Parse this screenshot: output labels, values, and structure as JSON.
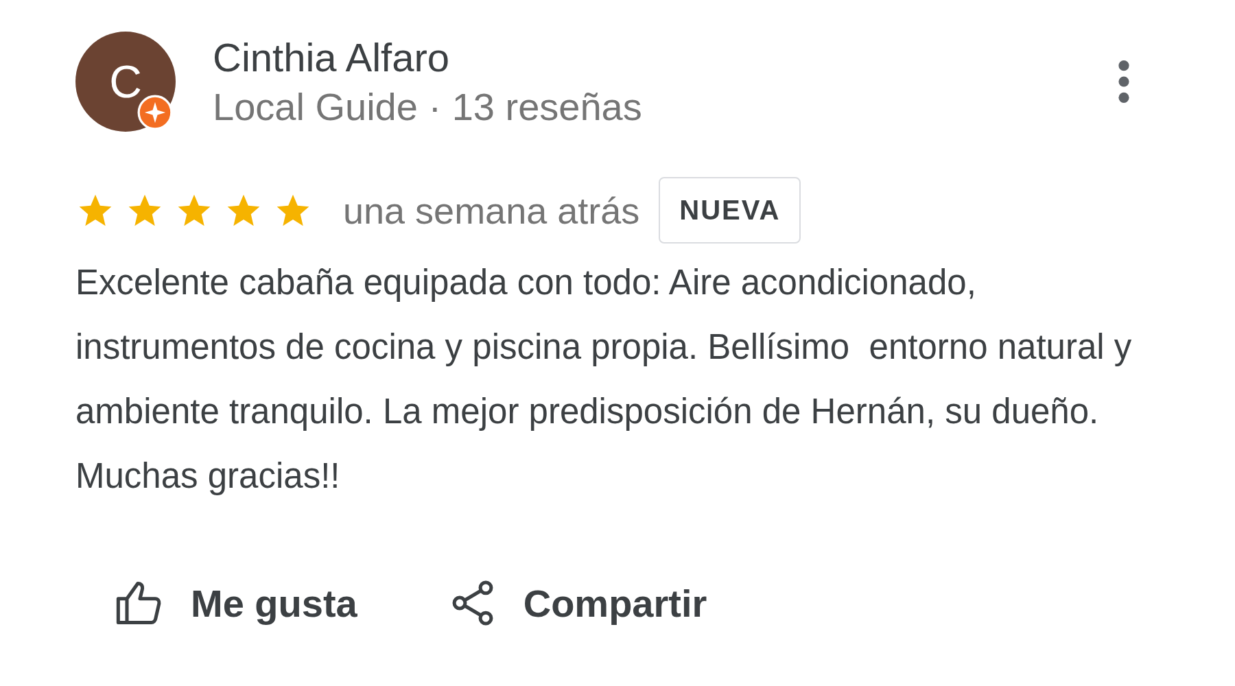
{
  "review": {
    "avatar_letter": "C",
    "author": "Cinthia Alfaro",
    "author_meta": "Local Guide · 13 reseñas",
    "stars": 5,
    "time": "una semana atrás",
    "badge": "NUEVA",
    "text": "Excelente cabaña equipada con todo: Aire acondicionado, instrumentos de cocina y piscina propia. Bellísimo  entorno natural y ambiente tranquilo. La mejor predisposición de Hernán, su dueño. Muchas gracias!!"
  },
  "actions": [
    {
      "kind": "like",
      "label": "Me gusta"
    },
    {
      "kind": "share",
      "label": "Compartir"
    }
  ]
}
